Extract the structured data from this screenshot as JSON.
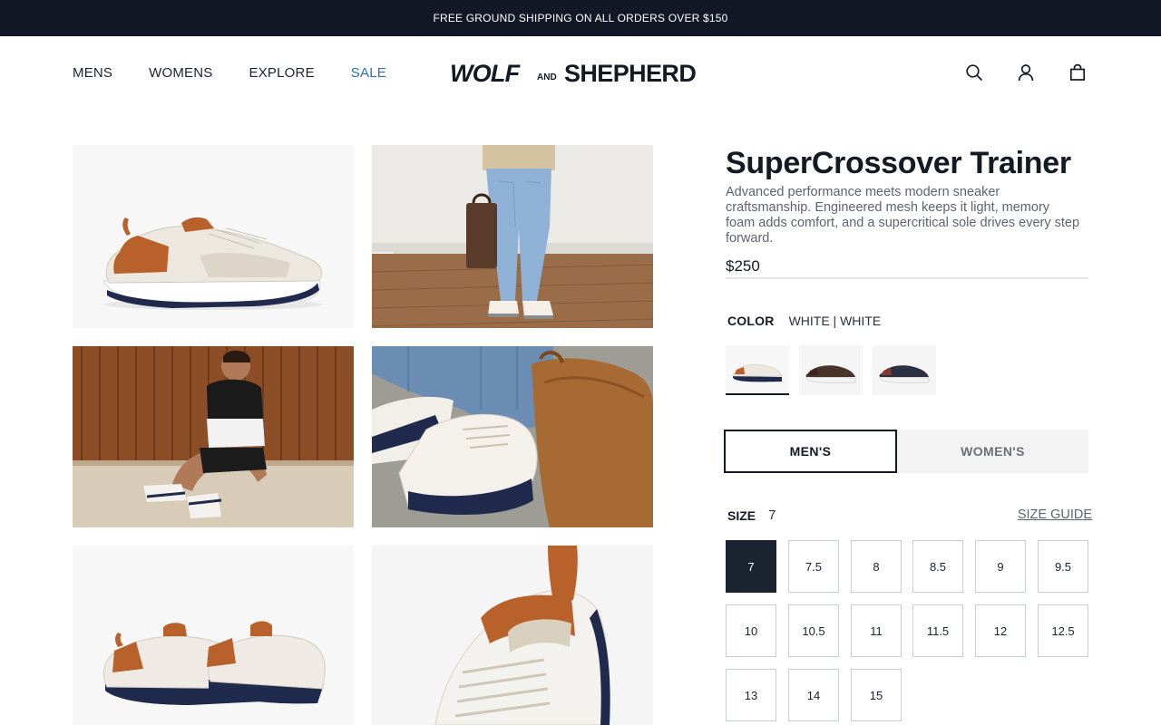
{
  "promo": {
    "text": "FREE GROUND SHIPPING ON ALL ORDERS OVER $150"
  },
  "nav": {
    "items": [
      "MENS",
      "WOMENS",
      "EXPLORE",
      "SALE"
    ]
  },
  "logo": {
    "text": "WOLF AND SHEPHERD"
  },
  "header_icons": [
    "search-icon",
    "account-icon",
    "cart-icon"
  ],
  "product": {
    "title": "SuperCrossover Trainer",
    "description": "Advanced performance meets modern sneaker craftsmanship. Engineered mesh keeps it light, memory foam adds comfort, and a supercritical sole drives every step forward.",
    "price": "$250",
    "color_label": "COLOR",
    "color_value": "WHITE | WHITE",
    "gender_options": [
      "MEN'S",
      "WOMEN'S"
    ],
    "selected_gender": "MEN'S",
    "size_label": "SIZE",
    "size_value": "7",
    "size_guide": "SIZE GUIDE",
    "sizes": [
      "7",
      "7.5",
      "8",
      "8.5",
      "9",
      "9.5",
      "10",
      "10.5",
      "11",
      "11.5",
      "12",
      "12.5",
      "13",
      "14",
      "15"
    ],
    "selected_size": "7"
  },
  "colors": {
    "promo_bg": "#121826",
    "accent_sale": "#2f6fa8",
    "selected_size_bg": "#1b2230"
  }
}
